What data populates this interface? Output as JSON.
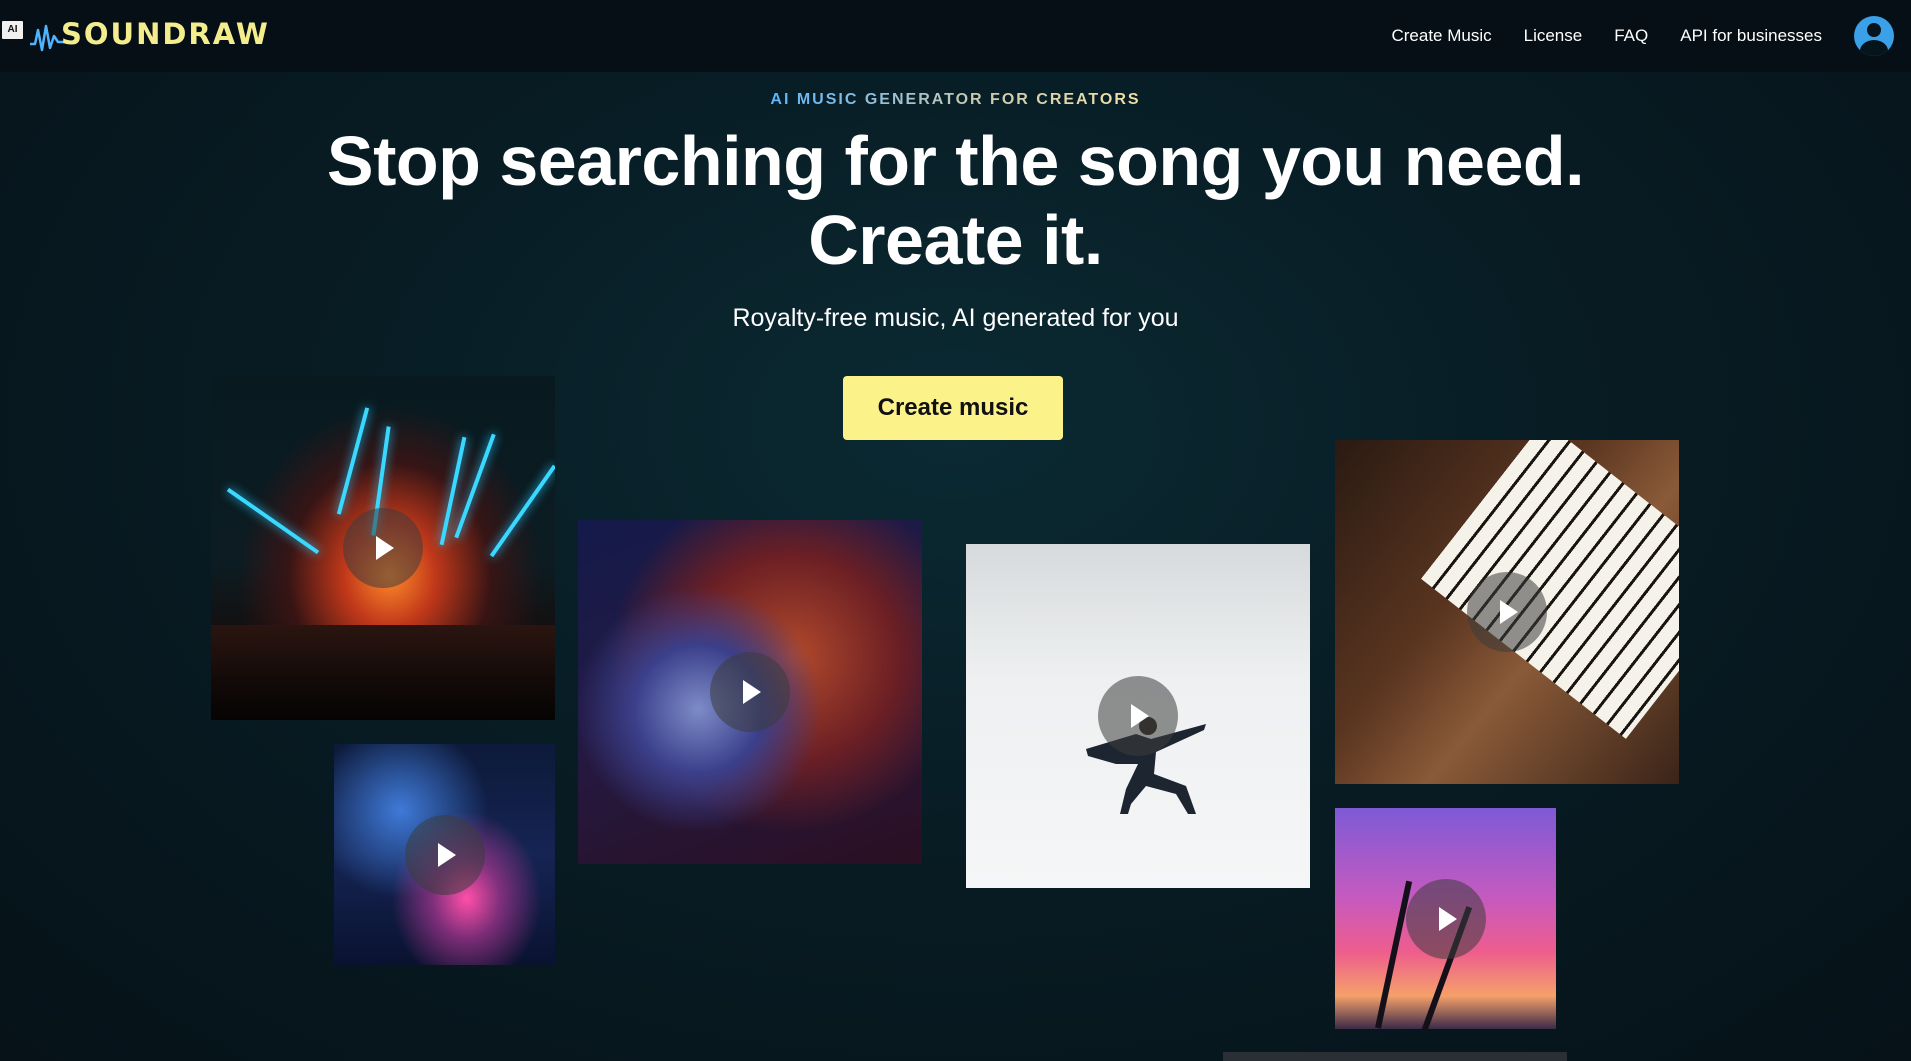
{
  "header": {
    "ai_badge": "AI",
    "logo_text": "SOUNDRAW",
    "nav": [
      "Create Music",
      "License",
      "FAQ",
      "API for businesses"
    ],
    "avatar_icon": "user-avatar-icon"
  },
  "hero": {
    "eyebrow": "AI MUSIC GENERATOR FOR CREATORS",
    "headline_line1": "Stop searching for the song you need.",
    "headline_line2": "Create it.",
    "subheadline": "Royalty-free music, AI generated for you",
    "cta_label": "Create music"
  },
  "colors": {
    "background": "#081c24",
    "header_bg": "#050f15",
    "logo": "#f4ed8e",
    "cta_bg": "#fbf28a",
    "avatar": "#3aa0e8"
  },
  "media_tiles": [
    {
      "name": "concert",
      "icon": "play-icon"
    },
    {
      "name": "disco-ball",
      "icon": "play-icon"
    },
    {
      "name": "dancer",
      "icon": "play-icon"
    },
    {
      "name": "piano",
      "icon": "play-icon"
    },
    {
      "name": "city-night",
      "icon": "play-icon"
    },
    {
      "name": "palm-sunset",
      "icon": "play-icon"
    }
  ]
}
